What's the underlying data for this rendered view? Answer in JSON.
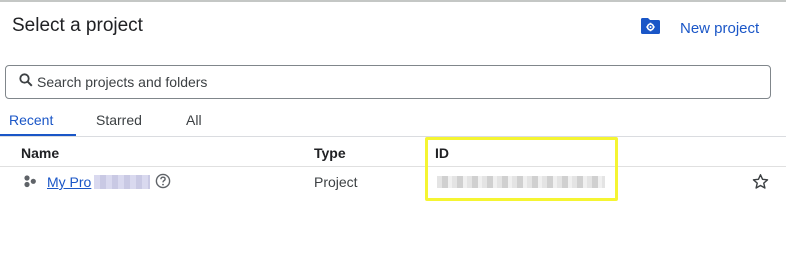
{
  "dialog": {
    "title": "Select a project",
    "new_project_label": "New project"
  },
  "search": {
    "placeholder": "Search projects and folders",
    "value": ""
  },
  "tabs": [
    {
      "label": "Recent",
      "active": true
    },
    {
      "label": "Starred",
      "active": false
    },
    {
      "label": "All",
      "active": false
    }
  ],
  "table": {
    "columns": [
      "Name",
      "Type",
      "ID"
    ],
    "rows": [
      {
        "name": "My Pro",
        "type": "Project",
        "id": ""
      }
    ]
  },
  "colors": {
    "accent": "#1a56c7",
    "highlight": "#f5f532"
  },
  "icons": [
    "new-folder-icon",
    "search-icon",
    "project-icon",
    "help-icon",
    "star-icon"
  ]
}
